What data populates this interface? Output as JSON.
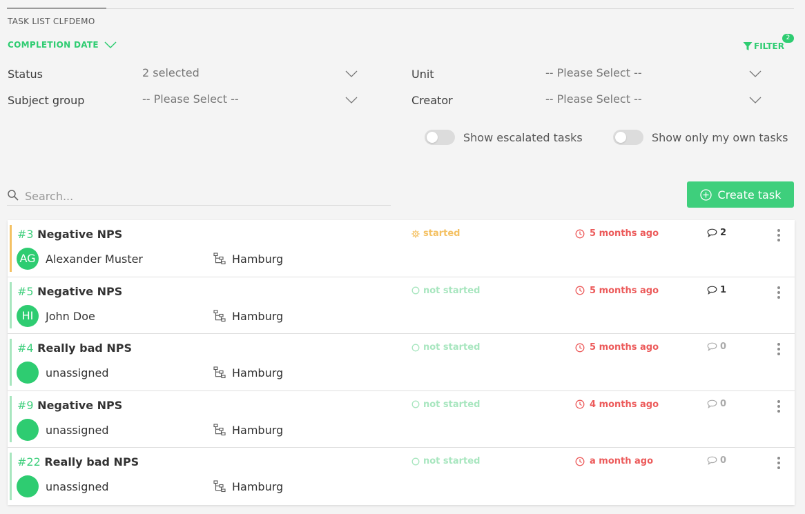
{
  "page_title": "TASK LIST CLFDEMO",
  "sort": {
    "label": "COMPLETION DATE",
    "icon": "chevron-down-icon"
  },
  "filter": {
    "label": "FILTER",
    "badge": "2",
    "icon": "funnel-icon"
  },
  "filters": {
    "status": {
      "label": "Status",
      "value": "2 selected"
    },
    "subject_group": {
      "label": "Subject group",
      "value": "-- Please Select --"
    },
    "unit": {
      "label": "Unit",
      "value": "-- Please Select --"
    },
    "creator": {
      "label": "Creator",
      "value": "-- Please Select --"
    }
  },
  "toggles": {
    "escalated": {
      "label": "Show escalated tasks",
      "on": false
    },
    "own": {
      "label": "Show only my own tasks",
      "on": false
    }
  },
  "search": {
    "placeholder": "Search...",
    "value": ""
  },
  "create_button": {
    "label": "Create task",
    "icon": "plus-circle-icon"
  },
  "colors": {
    "accent": "#3ecf7c",
    "started": "#f4c163",
    "not_started": "#a8e6bf",
    "due": "#ec5a5a"
  },
  "tasks": [
    {
      "id": "#3",
      "title": "Negative NPS",
      "avatar": "AG",
      "assignee": "Alexander Muster",
      "unit": "Hamburg",
      "status": "started",
      "due": "5 months ago",
      "comments": "2"
    },
    {
      "id": "#5",
      "title": "Negative NPS",
      "avatar": "HI",
      "assignee": "John Doe",
      "unit": "Hamburg",
      "status": "not started",
      "due": "5 months ago",
      "comments": "1"
    },
    {
      "id": "#4",
      "title": "Really bad NPS",
      "avatar": "",
      "assignee": "unassigned",
      "unit": "Hamburg",
      "status": "not started",
      "due": "5 months ago",
      "comments": "0"
    },
    {
      "id": "#9",
      "title": "Negative NPS",
      "avatar": "",
      "assignee": "unassigned",
      "unit": "Hamburg",
      "status": "not started",
      "due": "4 months ago",
      "comments": "0"
    },
    {
      "id": "#22",
      "title": "Really bad NPS",
      "avatar": "",
      "assignee": "unassigned",
      "unit": "Hamburg",
      "status": "not started",
      "due": "a month ago",
      "comments": "0"
    }
  ]
}
